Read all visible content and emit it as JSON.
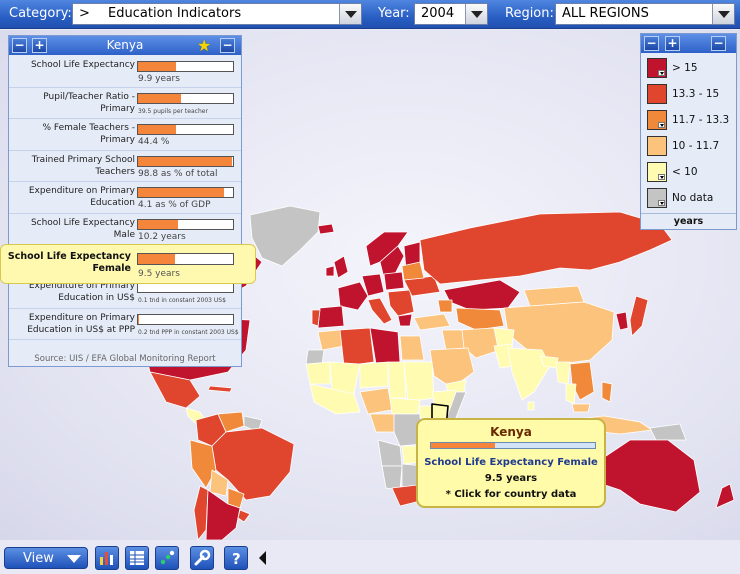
{
  "topbar": {
    "category_label": "Category:",
    "category_value": ">",
    "category_text": "Education Indicators",
    "year_label": "Year:",
    "year_value": "2004",
    "region_label": "Region:",
    "region_value": "ALL REGIONS"
  },
  "panel": {
    "country": "Kenya",
    "minus": "−",
    "plus": "+",
    "source": "Source: UIS / EFA Global Monitoring Report",
    "indicators": [
      {
        "label": "School Life Expectancy",
        "value_text": "9.9 years",
        "fill": 0.4
      },
      {
        "label": "Pupil/Teacher Ratio - Primary",
        "value_text": "39.5 pupils per teacher",
        "fill": 0.45
      },
      {
        "label": "% Female Teachers - Primary",
        "value_text": "44.4 %",
        "fill": 0.4
      },
      {
        "label": "Trained Primary School Teachers",
        "value_text": "98.8 as % of total",
        "fill": 0.99
      },
      {
        "label": "Expenditure on Primary Education",
        "value_text": "4.1 as % of GDP",
        "fill": 0.9
      },
      {
        "label": "School Life Expectancy Male",
        "value_text": "10.2 years",
        "fill": 0.42
      },
      {
        "label": "Expenditure on Primary Education in US$",
        "value_text": "0.1 tnd in constant 2003 US$",
        "fill": 0.0
      },
      {
        "label": "Expenditure on Primary Education in US$ at PPP",
        "value_text": "0.2 tnd PPP in constant 2003 US$",
        "fill": 0.01
      }
    ],
    "highlighted": {
      "label": "School Life Expectancy Female",
      "value_text": "9.5 years",
      "fill": 0.39
    }
  },
  "legend": {
    "items": [
      {
        "label": "> 15",
        "color": "#c0132d"
      },
      {
        "label": "13.3 - 15",
        "color": "#e0452e"
      },
      {
        "label": "11.7 - 13.3",
        "color": "#f08a3a"
      },
      {
        "label": "10 - 11.7",
        "color": "#fbc37b"
      },
      {
        "label": "< 10",
        "color": "#fffbb0"
      },
      {
        "label": "No data",
        "color": "#c4c4c4"
      }
    ],
    "unit": "years"
  },
  "tooltip": {
    "country": "Kenya",
    "indicator": "School Life Expectancy Female",
    "value": "9.5 years",
    "cta": "* Click for country data",
    "fill": 0.39
  },
  "toolbar": {
    "view_label": "View",
    "tools": [
      "bar-chart-icon",
      "table-icon",
      "scatter-plot-icon",
      "wrench-icon",
      "help-icon"
    ]
  }
}
